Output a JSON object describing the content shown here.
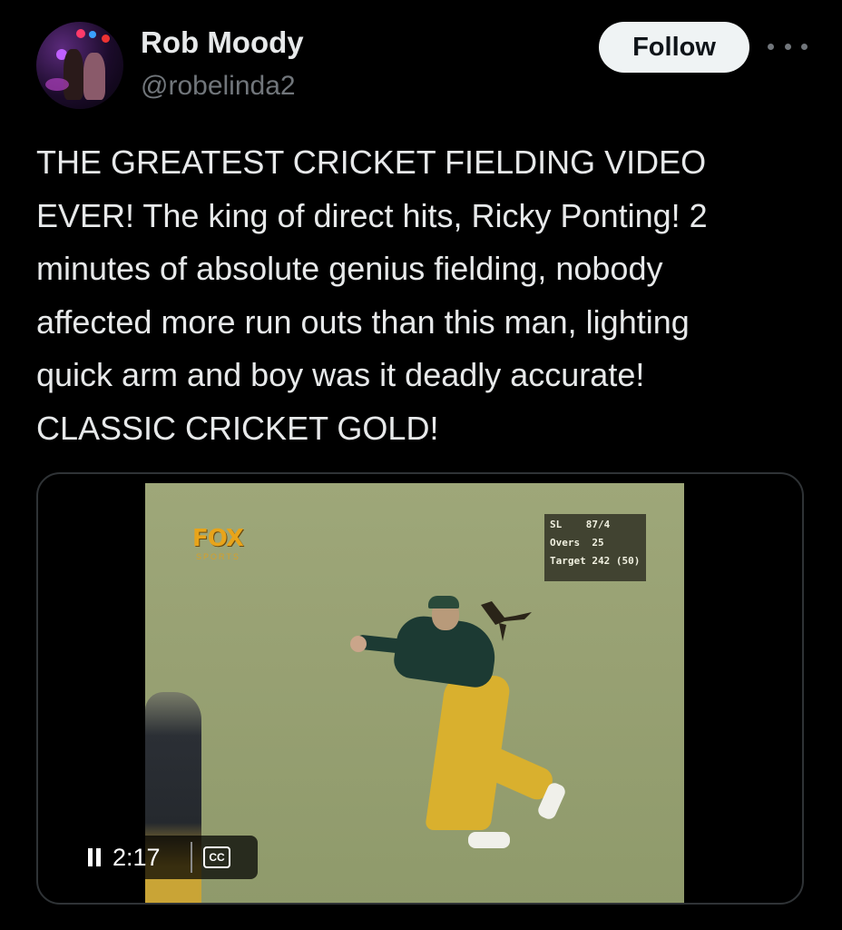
{
  "author": {
    "name": "Rob Moody",
    "handle": "@robelinda2"
  },
  "follow_label": "Follow",
  "more_icon": "more-horizontal-icon",
  "tweet_text": "THE GREATEST CRICKET FIELDING VIDEO\nEVER! The king of direct hits, Ricky Ponting! 2\nminutes of absolute genius fielding, nobody\naffected more run outs than this man, lighting\nquick arm and boy was it deadly accurate!\nCLASSIC CRICKET GOLD!",
  "video": {
    "broadcaster_logo": "FOX",
    "broadcaster_sub": "SPORTS",
    "scoreboard": {
      "line1": "SL    87/4",
      "line2": "Overs  25",
      "line3": "Target 242 (50)"
    },
    "time": "2:17",
    "state": "playing",
    "cc_label": "CC"
  },
  "colors": {
    "background": "#000000",
    "text": "#e7e9ea",
    "secondary": "#71767b",
    "follow_bg": "#eff3f4"
  }
}
